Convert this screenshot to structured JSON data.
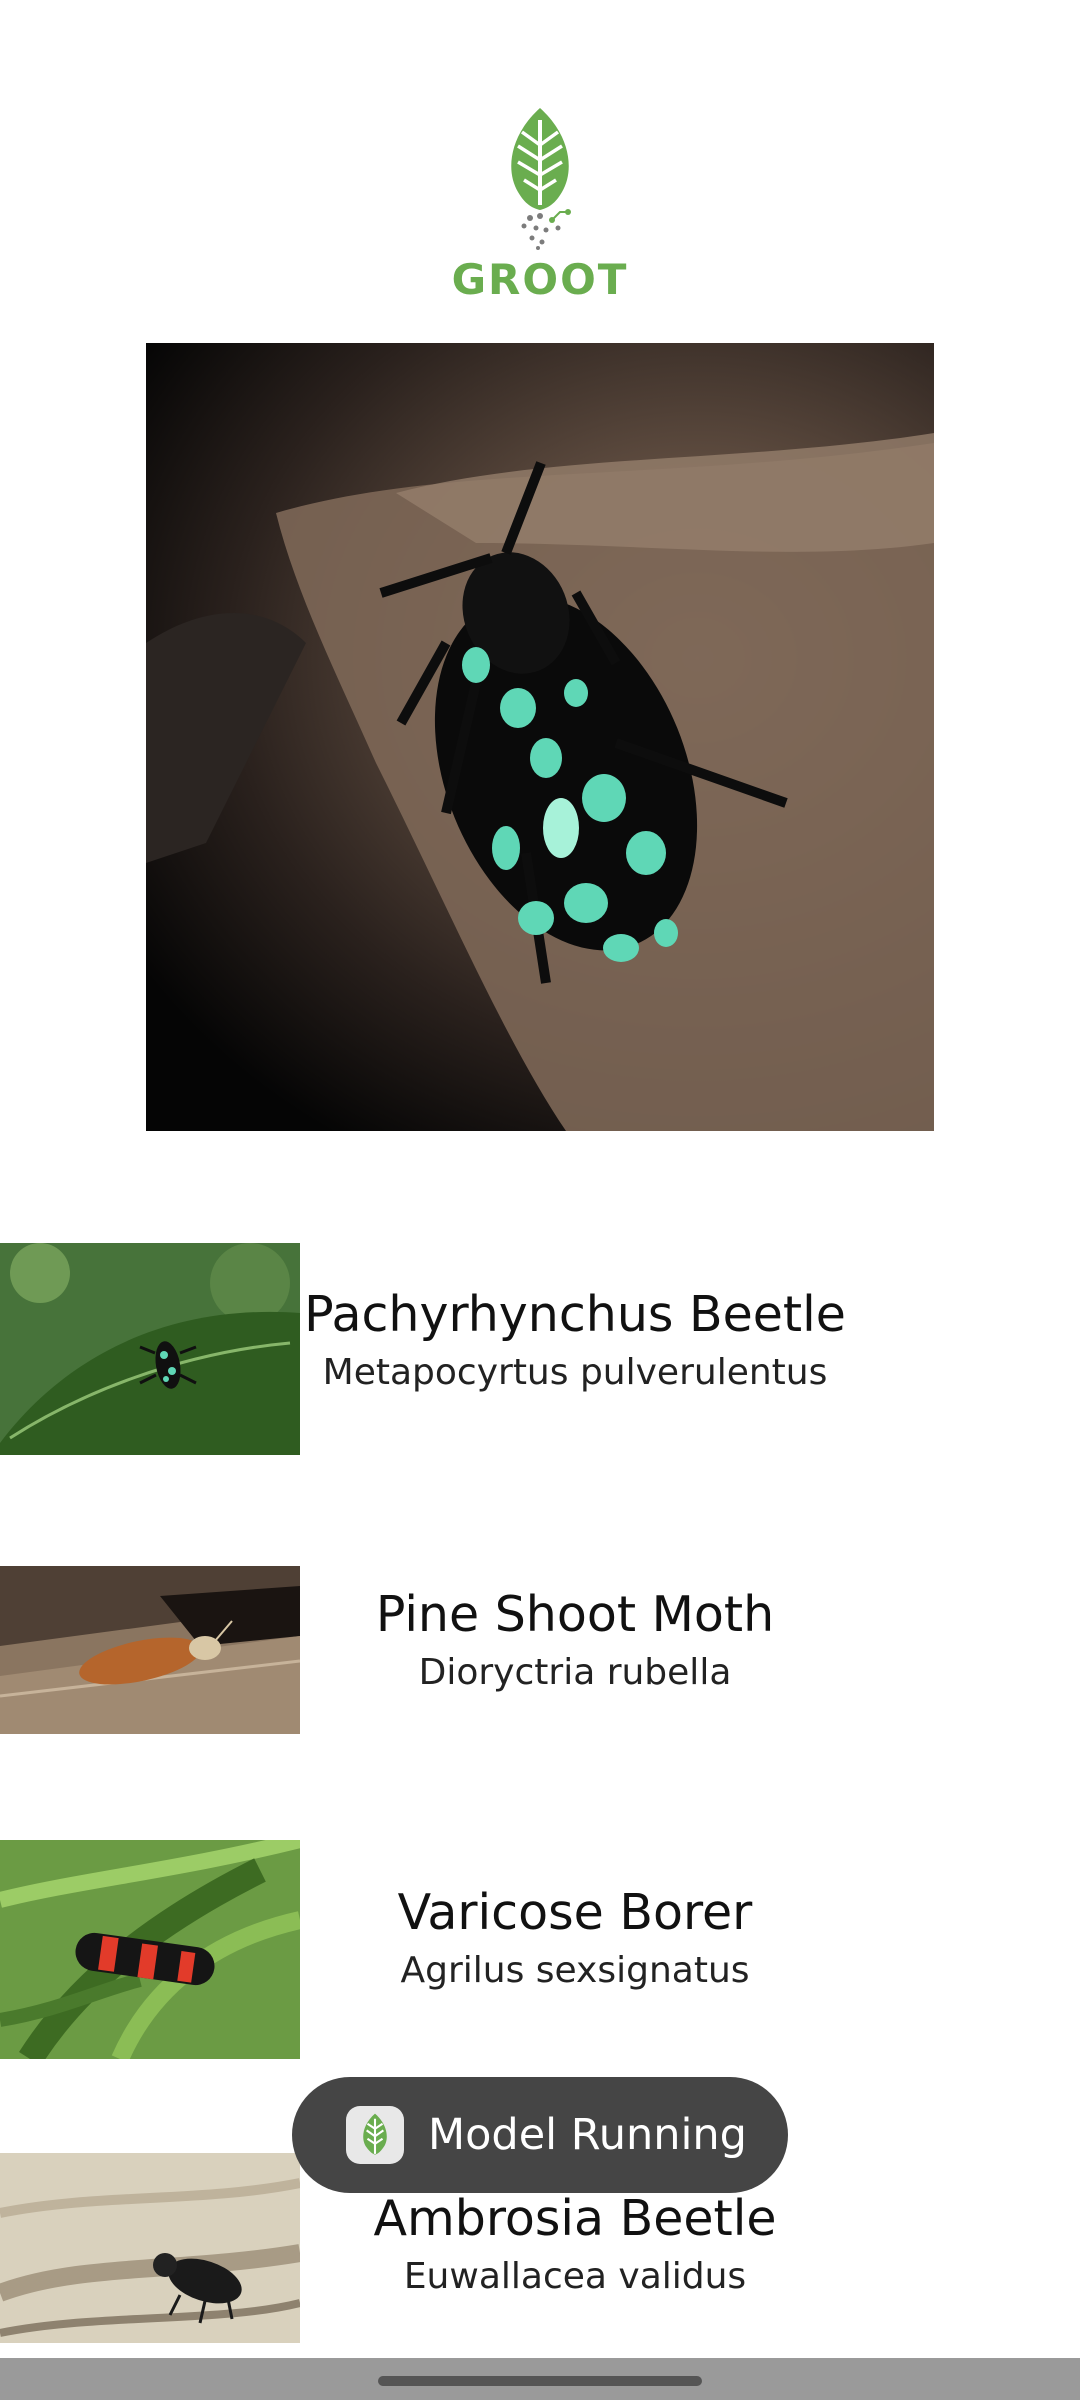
{
  "app": {
    "logo_text": "GROOT",
    "brand_color": "#6aad4f"
  },
  "hero_image": {
    "icon": "beetle-photo",
    "subject": "Pachyrhynchus beetle on dry leaf"
  },
  "results": [
    {
      "common_name": "Pachyrhynchus Beetle",
      "scientific_name": "Metapocyrtus pulverulentus",
      "thumbnail_icon": "beetle-on-leaf-photo"
    },
    {
      "common_name": "Pine Shoot Moth",
      "scientific_name": "Dioryctria rubella",
      "thumbnail_icon": "moth-on-wood-photo"
    },
    {
      "common_name": "Varicose Borer",
      "scientific_name": "Agrilus sexsignatus",
      "thumbnail_icon": "borer-on-fern-photo"
    },
    {
      "common_name": "Ambrosia Beetle",
      "scientific_name": "Euwallacea validus",
      "thumbnail_icon": "beetle-on-bark-photo"
    }
  ],
  "toast": {
    "label": "Model Running",
    "icon": "groot-leaf-icon"
  }
}
